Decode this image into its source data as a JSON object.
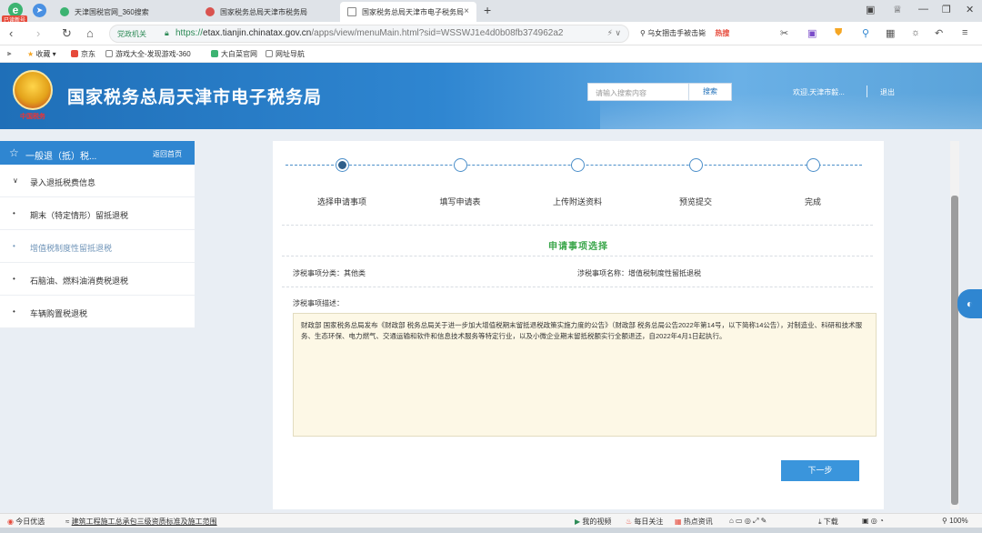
{
  "browser": {
    "badge": "已读新号",
    "tabs": [
      {
        "title": "天津国税官网_360搜索"
      },
      {
        "title": "国家税务总局天津市税务局"
      },
      {
        "title": "国家税务总局天津市电子税务局"
      }
    ],
    "address": {
      "gov_label": "党政机关",
      "url_scheme": "https://",
      "url_host": "etax.tianjin.chinatax.gov.cn",
      "url_rest": "/apps/view/menuMain.html?sid=WSSWJ1e4d0b08fb374962a2"
    },
    "search_suggest": "乌女捆击手被击毙",
    "search_hot": "热搜",
    "bookmarks": [
      {
        "label": "收藏"
      },
      {
        "label": "京东"
      },
      {
        "label": "游戏大全-发现游戏-360"
      },
      {
        "label": "大白菜官网"
      },
      {
        "label": "网址导航"
      }
    ]
  },
  "header": {
    "emblem_caption": "中国税务",
    "title": "国家税务总局天津市电子税务局",
    "search_placeholder": "请输入搜索内容",
    "search_button": "搜索",
    "welcome": "欢迎,天津市毅...",
    "logout": "退出"
  },
  "sidebar": {
    "title": "一般退（抵）税...",
    "back": "返回首页",
    "items": [
      {
        "bullet": "∨",
        "label": "录入退抵税费信息"
      },
      {
        "bullet": "•",
        "label": "期末（特定情形）留抵退税"
      },
      {
        "bullet": "•",
        "label": "增值税制度性留抵退税"
      },
      {
        "bullet": "•",
        "label": "石脑油、燃料油消费税退税"
      },
      {
        "bullet": "•",
        "label": "车辆购置税退税"
      }
    ]
  },
  "steps": [
    {
      "label": "选择申请事项",
      "done": true
    },
    {
      "label": "填写申请表",
      "done": false
    },
    {
      "label": "上传附送资料",
      "done": false
    },
    {
      "label": "预览提交",
      "done": false
    },
    {
      "label": "完成",
      "done": false
    }
  ],
  "form": {
    "section_title": "申请事项选择",
    "category": "涉税事项分类：其他类",
    "item_name": "涉税事项名称：增值税制度性留抵退税",
    "desc_label": "涉税事项描述：",
    "description": "财政部 国家税务总局发布《财政部 税务总局关于进一步加大增值税期末留抵退税政策实施力度的公告》（财政部 税务总局公告2022年第14号，以下简称14公告），对制造业、科研和技术服务、生态环保、电力燃气、交通运输和软件和信息技术服务等特定行业，以及小微企业期末留抵税额实行全额退还，自2022年4月1日起执行。",
    "next_button": "下一步"
  },
  "statusbar": {
    "today": "今日优选",
    "news": "建筑工程施工总承包三级资质标准及施工范围",
    "video": "我的视频",
    "daily": "每日关注",
    "hot": "热点资讯",
    "download": "下载",
    "zoom": "100%"
  }
}
